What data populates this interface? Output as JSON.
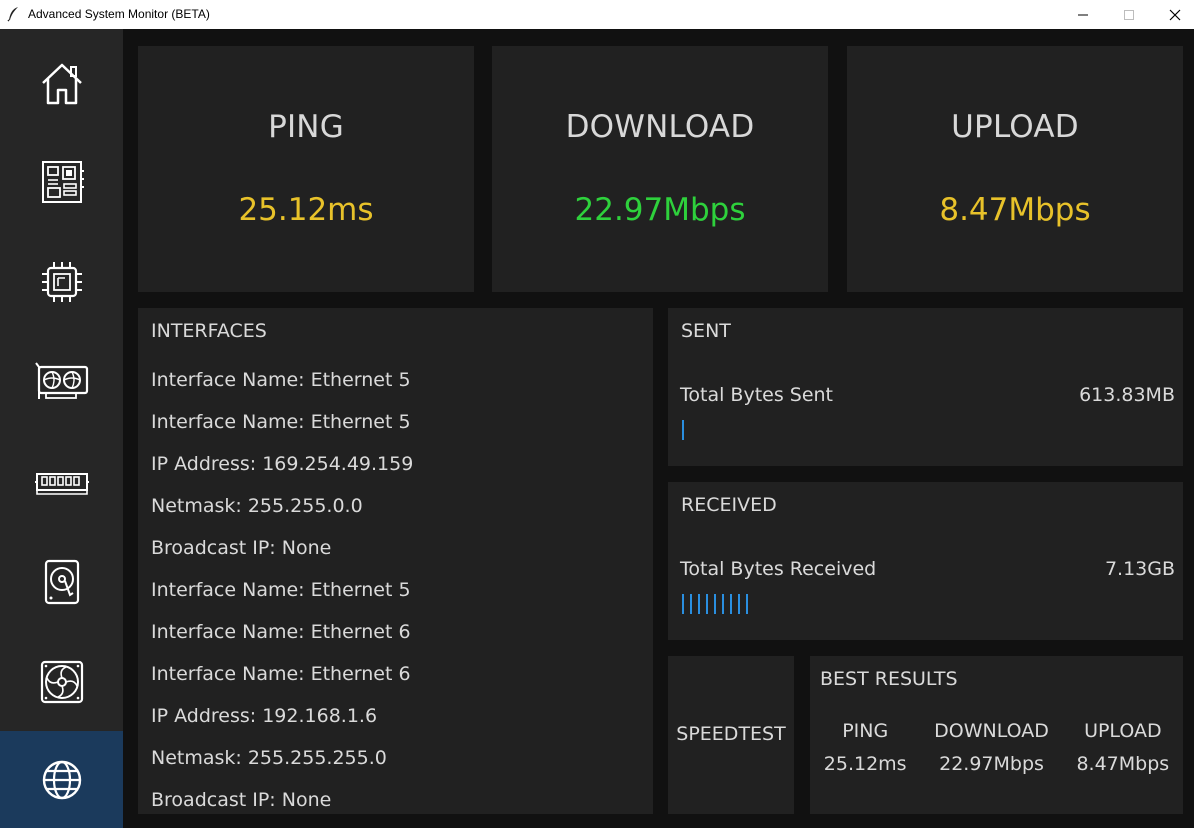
{
  "window": {
    "title": "Advanced System Monitor (BETA)",
    "minimize_icon": "minimize-icon",
    "maximize_icon": "maximize-icon",
    "close_icon": "close-icon"
  },
  "sidebar": {
    "items": [
      {
        "icon": "home-icon",
        "active": false
      },
      {
        "icon": "motherboard-icon",
        "active": false
      },
      {
        "icon": "cpu-icon",
        "active": false
      },
      {
        "icon": "gpu-icon",
        "active": false
      },
      {
        "icon": "ram-icon",
        "active": false
      },
      {
        "icon": "hard-drive-icon",
        "active": false
      },
      {
        "icon": "fan-icon",
        "active": false
      },
      {
        "icon": "globe-icon",
        "active": true
      }
    ]
  },
  "metrics": {
    "ping": {
      "title": "PING",
      "value": "25.12ms",
      "color": "#e8c22a"
    },
    "download": {
      "title": "DOWNLOAD",
      "value": "22.97Mbps",
      "color": "#2ed13c"
    },
    "upload": {
      "title": "UPLOAD",
      "value": "8.47Mbps",
      "color": "#e8c22a"
    }
  },
  "interfaces": {
    "title": "INTERFACES",
    "lines": [
      "Interface Name: Ethernet 5",
      "Interface Name: Ethernet 5",
      "IP Address: 169.254.49.159",
      "Netmask: 255.255.0.0",
      "Broadcast IP: None",
      "Interface Name: Ethernet 5",
      "Interface Name: Ethernet 6",
      "Interface Name: Ethernet 6",
      "IP Address: 192.168.1.6",
      "Netmask: 255.255.255.0",
      "Broadcast IP: None"
    ]
  },
  "sent": {
    "title": "SENT",
    "label": "Total Bytes Sent",
    "value": "613.83MB",
    "bar_ticks": 1,
    "bar_color": "#2a8fe0"
  },
  "received": {
    "title": "RECEIVED",
    "label": "Total Bytes Received",
    "value": "7.13GB",
    "bar_ticks": 9,
    "bar_color": "#2a8fe0"
  },
  "speedtest": {
    "button_label": "SPEEDTEST"
  },
  "best_results": {
    "title": "BEST RESULTS",
    "columns": [
      {
        "header": "PING",
        "value": "25.12ms"
      },
      {
        "header": "DOWNLOAD",
        "value": "22.97Mbps"
      },
      {
        "header": "UPLOAD",
        "value": "8.47Mbps"
      }
    ]
  },
  "colors": {
    "background": "#111111",
    "card": "#212121",
    "sidebar": "#262626",
    "sidebar_active": "#1b3a5c"
  }
}
